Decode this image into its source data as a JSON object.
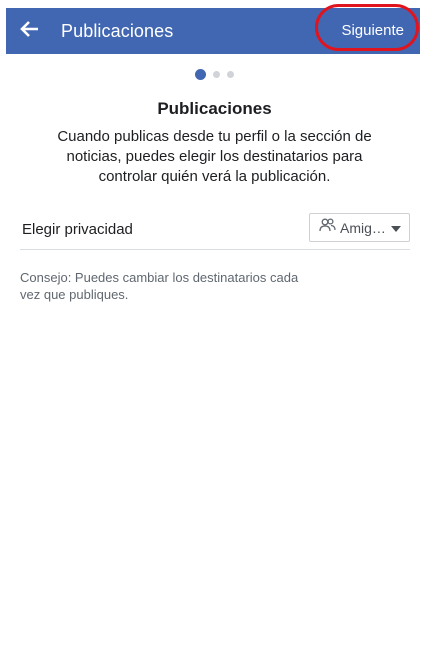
{
  "app_bar": {
    "title": "Publicaciones",
    "next_label": "Siguiente",
    "color": "#4267b2",
    "back_icon": "arrow-left-icon"
  },
  "pager": {
    "count": 3,
    "active_index": 0
  },
  "content": {
    "heading": "Publicaciones",
    "description": "Cuando publicas desde tu perfil o la sección de noticias, puedes elegir los destinatarios para controlar quién verá la publicación."
  },
  "privacy": {
    "label": "Elegir privacidad",
    "selected": "Amig…",
    "icon": "friends-icon",
    "dropdown_icon": "caret-down-icon"
  },
  "tip": "Consejo: Puedes cambiar los destinatarios cada vez que publiques.",
  "annotation": {
    "highlight_color": "#e0141e"
  }
}
